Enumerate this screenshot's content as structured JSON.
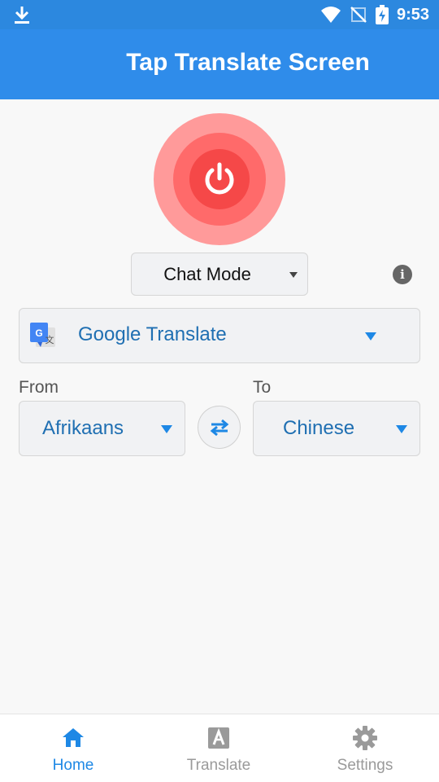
{
  "status_bar": {
    "time": "9:53",
    "icons": [
      "download-icon",
      "wifi-icon",
      "no-sim-icon",
      "battery-charging-icon"
    ]
  },
  "app_bar": {
    "title": "Tap Translate Screen"
  },
  "power_button": {
    "icon": "power-icon",
    "colors": {
      "outer": "#ff9a9a",
      "mid": "#ff6a6a",
      "inner": "#f54848"
    }
  },
  "mode": {
    "selected": "Chat Mode"
  },
  "engine": {
    "selected": "Google Translate",
    "icon": "google-translate-icon"
  },
  "languages": {
    "from_label": "From",
    "to_label": "To",
    "from_value": "Afrikaans",
    "to_value": "Chinese"
  },
  "bottom_nav": {
    "items": [
      {
        "label": "Home",
        "icon": "home-icon",
        "active": true
      },
      {
        "label": "Translate",
        "icon": "translate-icon",
        "active": false
      },
      {
        "label": "Settings",
        "icon": "gear-icon",
        "active": false
      }
    ]
  },
  "colors": {
    "primary": "#2f8cea",
    "accent_text": "#1f6fb2",
    "active_nav": "#1e88e5"
  }
}
